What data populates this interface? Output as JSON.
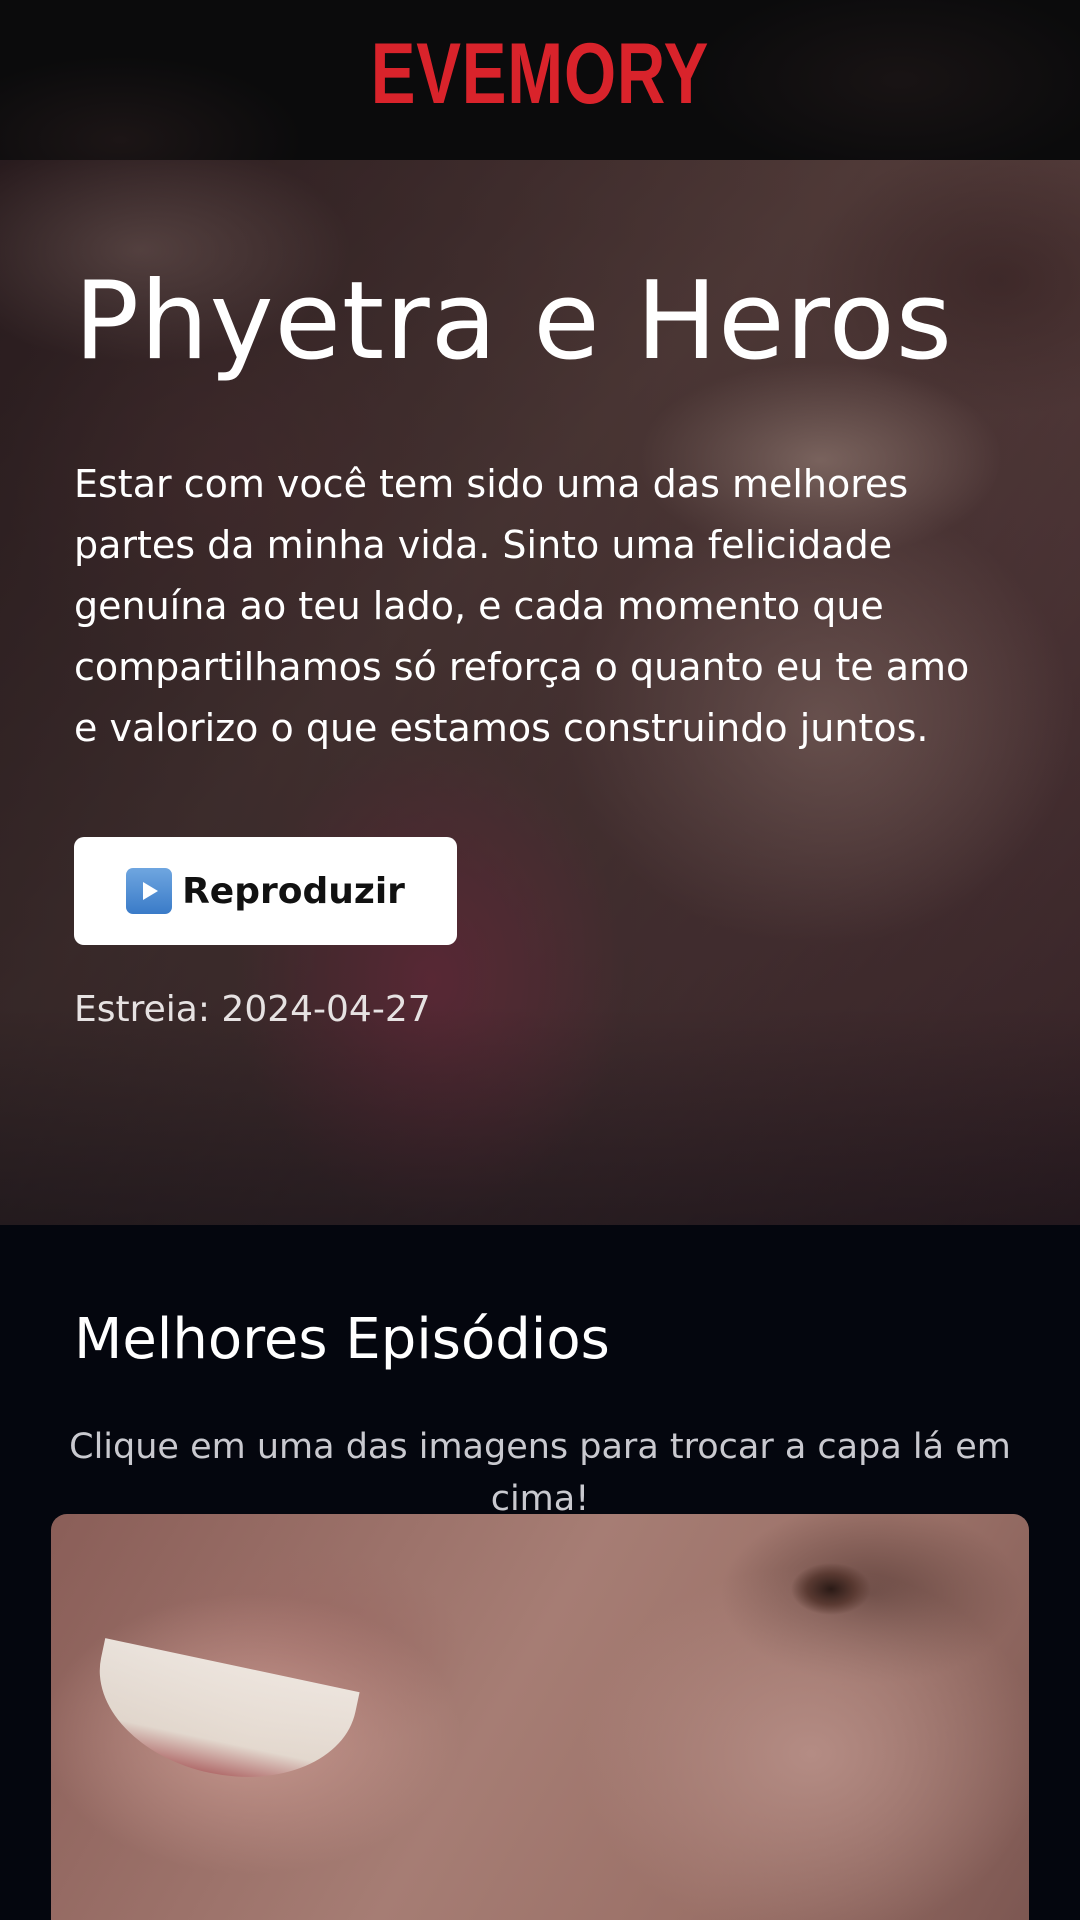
{
  "header": {
    "logo_text": "EVEMORY"
  },
  "hero": {
    "title": "Phyetra e Heros",
    "description": "Estar com você tem sido uma das melhores partes da minha vida. Sinto uma felicidade genuína ao teu lado, e cada momento que compartilhamos só reforça o quanto eu te amo e valorizo o que estamos construindo juntos.",
    "play_button_label": "Reproduzir",
    "play_button_icon": "play-button-emoji-icon",
    "premiere_text": "Estreia: 2024-04-27"
  },
  "episodes": {
    "title": "Melhores Episódios",
    "hint": "Clique em uma das imagens para trocar a capa lá em cima!"
  },
  "colors": {
    "brand": "#d9232b",
    "page_background": "#04060e",
    "header_background": "#0b0b0c",
    "button_background": "#ffffff"
  }
}
